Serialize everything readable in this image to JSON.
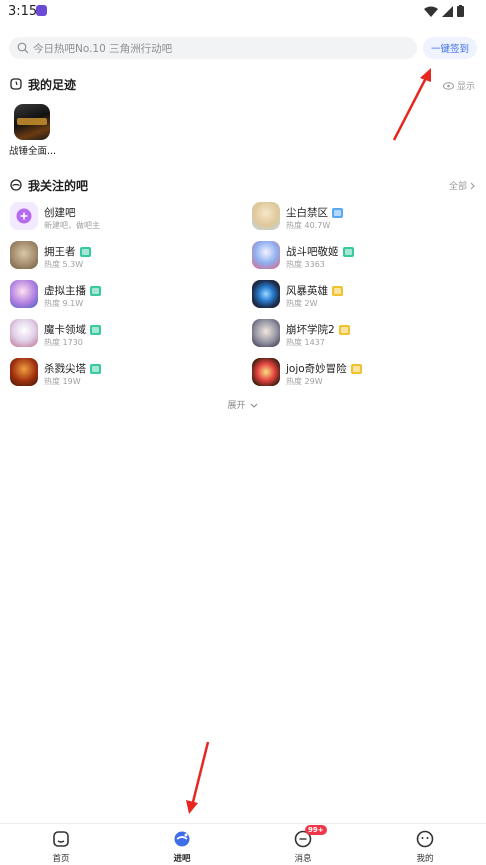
{
  "status": {
    "time": "3:15"
  },
  "search": {
    "placeholder": "今日热吧No.10 三角洲行动吧",
    "signin_label": "一键签到"
  },
  "footprints": {
    "title": "我的足迹",
    "toggle_label": "显示",
    "items": [
      {
        "name": "战锤全面..."
      }
    ]
  },
  "followed": {
    "title": "我关注的吧",
    "all_label": "全部",
    "items": [
      {
        "name": "创建吧",
        "sub": "新建吧，做吧主",
        "level_color": ""
      },
      {
        "name": "尘白禁区",
        "sub": "热度 40.7W",
        "level_color": "#5aa8f5"
      },
      {
        "name": "拥王者",
        "sub": "热度 5.3W",
        "level_color": "#38c9a0"
      },
      {
        "name": "战斗吧敬姬",
        "sub": "热度 3363",
        "level_color": "#38c9a0"
      },
      {
        "name": "虚拟主播",
        "sub": "热度 9.1W",
        "level_color": "#38c9a0"
      },
      {
        "name": "风暴英雄",
        "sub": "热度 2W",
        "level_color": "#f2c12e"
      },
      {
        "name": "魔卡领域",
        "sub": "热度 1730",
        "level_color": "#38c9a0"
      },
      {
        "name": "崩坏学院2",
        "sub": "热度 1437",
        "level_color": "#f2c12e"
      },
      {
        "name": "杀戮尖塔",
        "sub": "热度 19W",
        "level_color": "#38c9a0"
      },
      {
        "name": "jojo奇妙冒险",
        "sub": "热度 29W",
        "level_color": "#f2c12e"
      }
    ],
    "expand_label": "展开"
  },
  "nav": {
    "items": [
      {
        "label": "首页"
      },
      {
        "label": "进吧"
      },
      {
        "label": "消息",
        "badge": "99+"
      },
      {
        "label": "我的"
      }
    ]
  },
  "colors": {
    "accent": "#3d6ee8",
    "annotation": "#e8251f",
    "badge": "#f0364a"
  }
}
